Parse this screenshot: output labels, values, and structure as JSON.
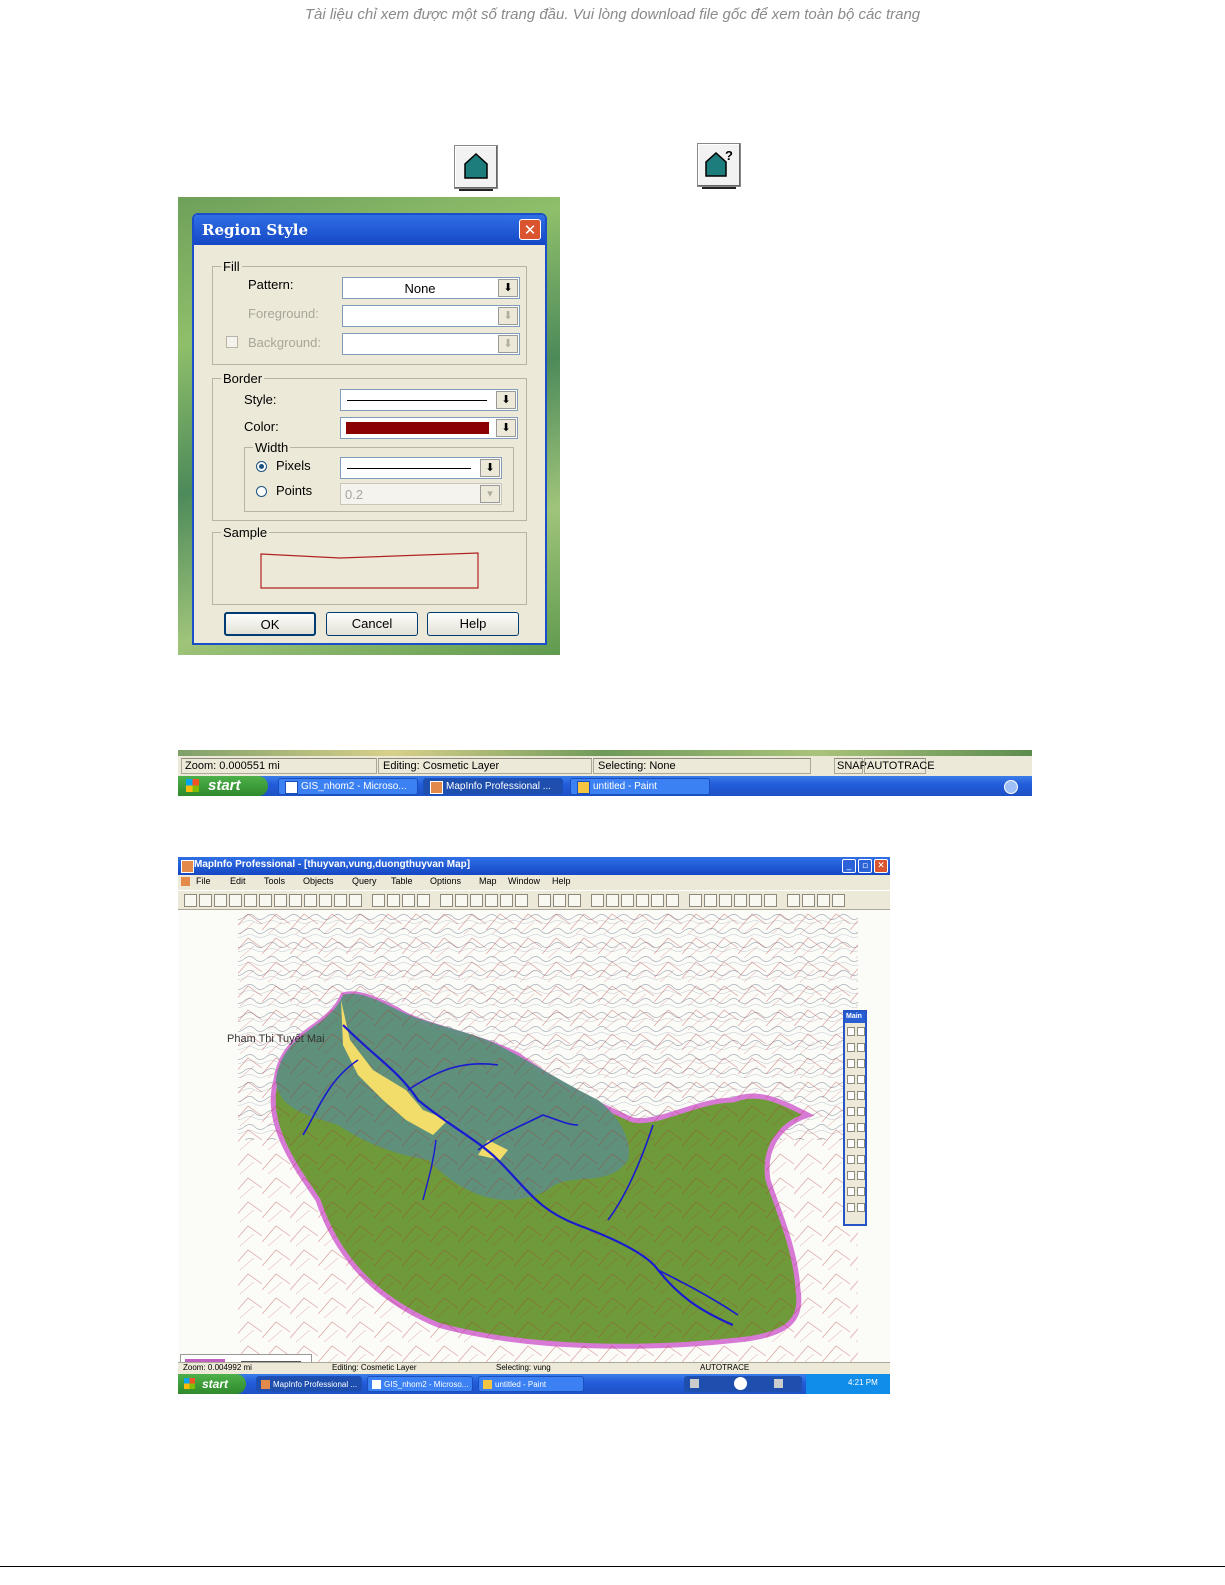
{
  "notice": "Tài liệu chỉ xem được một số trang đầu. Vui lòng download file gốc để xem toàn bộ các trang",
  "region_style_dialog": {
    "title": "Region Style",
    "fill": {
      "legend": "Fill",
      "pattern_label": "Pattern:",
      "pattern_value": "None",
      "foreground_label": "Foreground:",
      "background_label": "Background:"
    },
    "border": {
      "legend": "Border",
      "style_label": "Style:",
      "color_label": "Color:",
      "color_value": "#8b0000",
      "width_legend": "Width",
      "pixels_label": "Pixels",
      "points_label": "Points",
      "points_value": "0.2"
    },
    "sample_legend": "Sample",
    "ok_label": "OK",
    "cancel_label": "Cancel",
    "help_label": "Help"
  },
  "status_strip": {
    "zoom": "Zoom: 0.000551 mi",
    "editing": "Editing: Cosmetic Layer",
    "selecting": "Selecting: None",
    "snap": "SNAP",
    "autotrace": "AUTOTRACE",
    "start_label": "start",
    "tasks": [
      "GIS_nhom2 - Microso...",
      "MapInfo Professional ...",
      "untitled - Paint"
    ]
  },
  "mapinfo_window": {
    "title": "MapInfo Professional - [thuyvan,vung,duongthuyvan Map]",
    "menu": [
      "File",
      "Edit",
      "Tools",
      "Objects",
      "Query",
      "Table",
      "Options",
      "Map",
      "Window",
      "Help"
    ],
    "author_label": "Pham Thi Tuyết Mai",
    "palette_title": "Main",
    "status": {
      "zoom": "Zoom: 0.004992 mi",
      "editing": "Editing: Cosmetic Layer",
      "selecting": "Selecting: vung",
      "autotrace": "AUTOTRACE"
    },
    "start_label": "start",
    "tasks": [
      "MapInfo Professional ...",
      "GIS_nhom2 - Microso...",
      "untitled - Paint"
    ],
    "clock": "4:21 PM"
  },
  "colors": {
    "map_green": "#6f9a3a",
    "map_teal": "#5d8f7e",
    "river_blue": "#1a1ad0",
    "boundary_magenta": "#d77ad6",
    "patch_yellow": "#f2dc6a"
  }
}
